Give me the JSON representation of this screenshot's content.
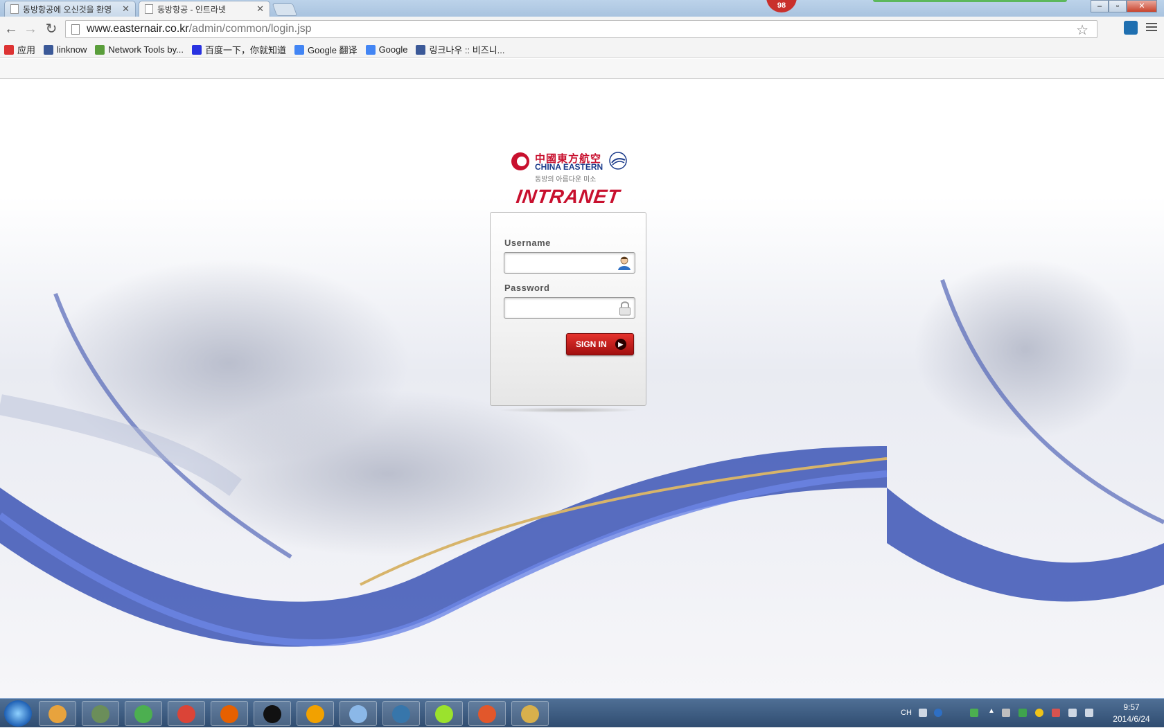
{
  "tabs": [
    {
      "title": "동방항공에 오신것을 환영",
      "active": false
    },
    {
      "title": "동방항공 - 인트라넷",
      "active": true
    }
  ],
  "notification_count": "98",
  "address_bar": {
    "host": "www.easternair.co.kr",
    "path": "/admin/common/login.jsp"
  },
  "bookmarks": [
    {
      "label": "应用",
      "icon": "apps-grid-icon",
      "color": "#d33"
    },
    {
      "label": "linknow",
      "icon": "linknow-icon",
      "color": "#3b5998"
    },
    {
      "label": "Network Tools by...",
      "icon": "globe-icon",
      "color": "#5a9e3b"
    },
    {
      "label": "百度一下，你就知道",
      "icon": "baidu-icon",
      "color": "#2932e1"
    },
    {
      "label": "Google 翻译",
      "icon": "translate-icon",
      "color": "#4285f4"
    },
    {
      "label": "Google",
      "icon": "google-icon",
      "color": "#4285f4"
    },
    {
      "label": "링크나우 :: 비즈니...",
      "icon": "linknow-icon",
      "color": "#3b5998"
    }
  ],
  "logo": {
    "chinese": "中國東方航空",
    "english": "CHINA EASTERN",
    "korean": "동방의 아름다운 미소"
  },
  "intranet_title": "INTRANET",
  "login": {
    "username_label": "Username",
    "username_value": "",
    "password_label": "Password",
    "password_value": "",
    "signin_label": "SIGN IN"
  },
  "taskbar": {
    "apps": [
      {
        "name": "picasa-icon",
        "color": "#e8a33d"
      },
      {
        "name": "computer-icon",
        "color": "#6b8e5a"
      },
      {
        "name": "refresh-app-icon",
        "color": "#4caf50"
      },
      {
        "name": "chrome-icon",
        "color": "#db4437"
      },
      {
        "name": "firefox-icon",
        "color": "#e66000"
      },
      {
        "name": "cmd-icon",
        "color": "#111111"
      },
      {
        "name": "app-n-icon",
        "color": "#f2a100"
      },
      {
        "name": "notepad-icon",
        "color": "#8bb8e8"
      },
      {
        "name": "python-icon",
        "color": "#3776ab"
      },
      {
        "name": "ball-icon",
        "color": "#9be22d"
      },
      {
        "name": "office-icon",
        "color": "#e2572b"
      },
      {
        "name": "paint-icon",
        "color": "#d8b04c"
      }
    ],
    "input_lang": "CH",
    "clock_time": "9:57",
    "clock_date": "2014/6/24"
  }
}
